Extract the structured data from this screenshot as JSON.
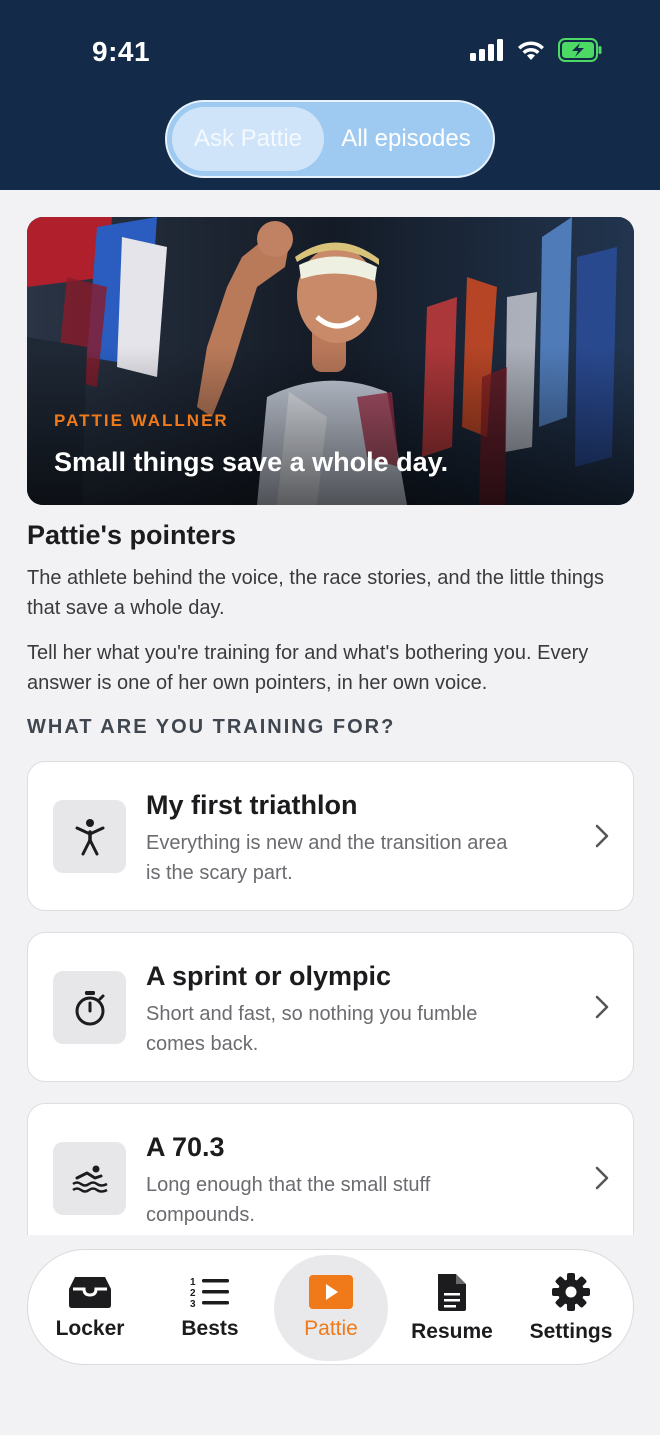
{
  "status": {
    "time": "9:41"
  },
  "segmented": {
    "active": "Ask Pattie",
    "inactive": "All episodes"
  },
  "hero": {
    "eyebrow": "PATTIE WALLNER",
    "title": "Small things save a whole day."
  },
  "intro": {
    "title": "Pattie's pointers",
    "p1": "The athlete behind the voice, the race stories, and the little things that save a whole day.",
    "p2": "Tell her what you're training for and what's bothering you. Every answer is one of her own pointers, in her own voice."
  },
  "question": "WHAT ARE YOU TRAINING FOR?",
  "cards": [
    {
      "icon": "person-icon",
      "title": "My first triathlon",
      "desc": "Everything is new and the transition area is the scary part."
    },
    {
      "icon": "stopwatch-icon",
      "title": "A sprint or olympic",
      "desc": "Short and fast, so nothing you fumble comes back."
    },
    {
      "icon": "swimmer-icon",
      "title": "A 70.3",
      "desc": "Long enough that the small stuff compounds."
    }
  ],
  "tabs": [
    {
      "label": "Locker",
      "icon": "locker-icon"
    },
    {
      "label": "Bests",
      "icon": "numbered-list-icon"
    },
    {
      "label": "Pattie",
      "icon": "play-icon",
      "active": true
    },
    {
      "label": "Resume",
      "icon": "document-icon"
    },
    {
      "label": "Settings",
      "icon": "gear-icon"
    }
  ],
  "colors": {
    "header": "#132a48",
    "accent": "#f07a1a",
    "segment": "#9ec9f0"
  }
}
